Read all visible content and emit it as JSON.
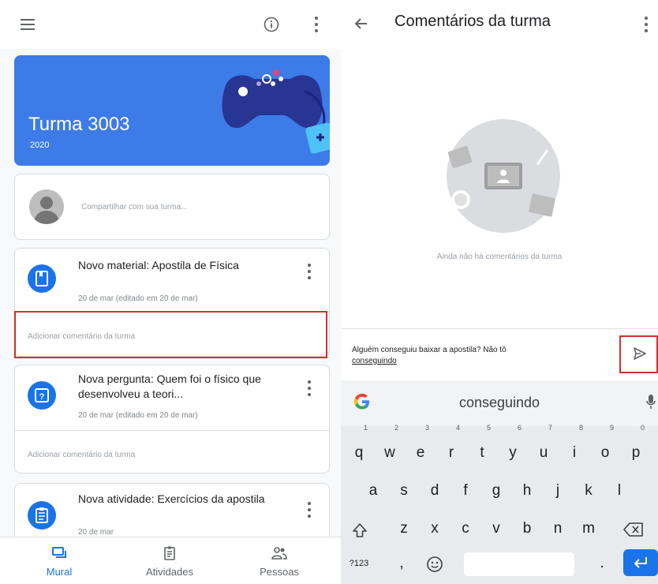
{
  "left_panel": {
    "class_card": {
      "title": "Turma 3003",
      "year": "2020"
    },
    "share": {
      "placeholder": "Compartilhar com sua turma..."
    },
    "posts": [
      {
        "title": "Novo material: Apostila de Física",
        "date": "20 de mar (editado em 20 de mar)",
        "comment_prompt": "Adicionar comentário da turma",
        "icon": "material-icon"
      },
      {
        "title": "Nova pergunta: Quem foi o físico que desenvolveu a teori...",
        "date": "20 de mar (editado em 20 de mar)",
        "comment_prompt": "Adicionar comentário da turma",
        "icon": "question-icon"
      },
      {
        "title": "Nova atividade: Exercícios da apostila",
        "date": "20 de mar",
        "icon": "assignment-icon"
      }
    ],
    "bottom_nav": [
      {
        "label": "Mural",
        "icon": "stream-icon",
        "active": true
      },
      {
        "label": "Atividades",
        "icon": "classwork-icon",
        "active": false
      },
      {
        "label": "Pessoas",
        "icon": "people-icon",
        "active": false
      }
    ]
  },
  "right_panel": {
    "title": "Comentários da turma",
    "empty_state": "Ainda não há comentários da turma",
    "composer": {
      "text": "Alguém conseguiu baixar a apostila? Não tô",
      "underlined_word": "conseguindo"
    }
  },
  "keyboard": {
    "suggestion": "conseguindo",
    "row1": [
      {
        "key": "q",
        "alt": "1"
      },
      {
        "key": "w",
        "alt": "2"
      },
      {
        "key": "e",
        "alt": "3"
      },
      {
        "key": "r",
        "alt": "4"
      },
      {
        "key": "t",
        "alt": "5"
      },
      {
        "key": "y",
        "alt": "6"
      },
      {
        "key": "u",
        "alt": "7"
      },
      {
        "key": "i",
        "alt": "8"
      },
      {
        "key": "o",
        "alt": "9"
      },
      {
        "key": "p",
        "alt": "0"
      }
    ],
    "row2": [
      "a",
      "s",
      "d",
      "f",
      "g",
      "h",
      "j",
      "k",
      "l"
    ],
    "row3": [
      "z",
      "x",
      "c",
      "v",
      "b",
      "n",
      "m"
    ],
    "symbols_label": "?123",
    "comma": ",",
    "period": "."
  },
  "colors": {
    "accent": "#1a73e8",
    "banner": "#3d7be8",
    "highlight": "#d32f2f"
  }
}
